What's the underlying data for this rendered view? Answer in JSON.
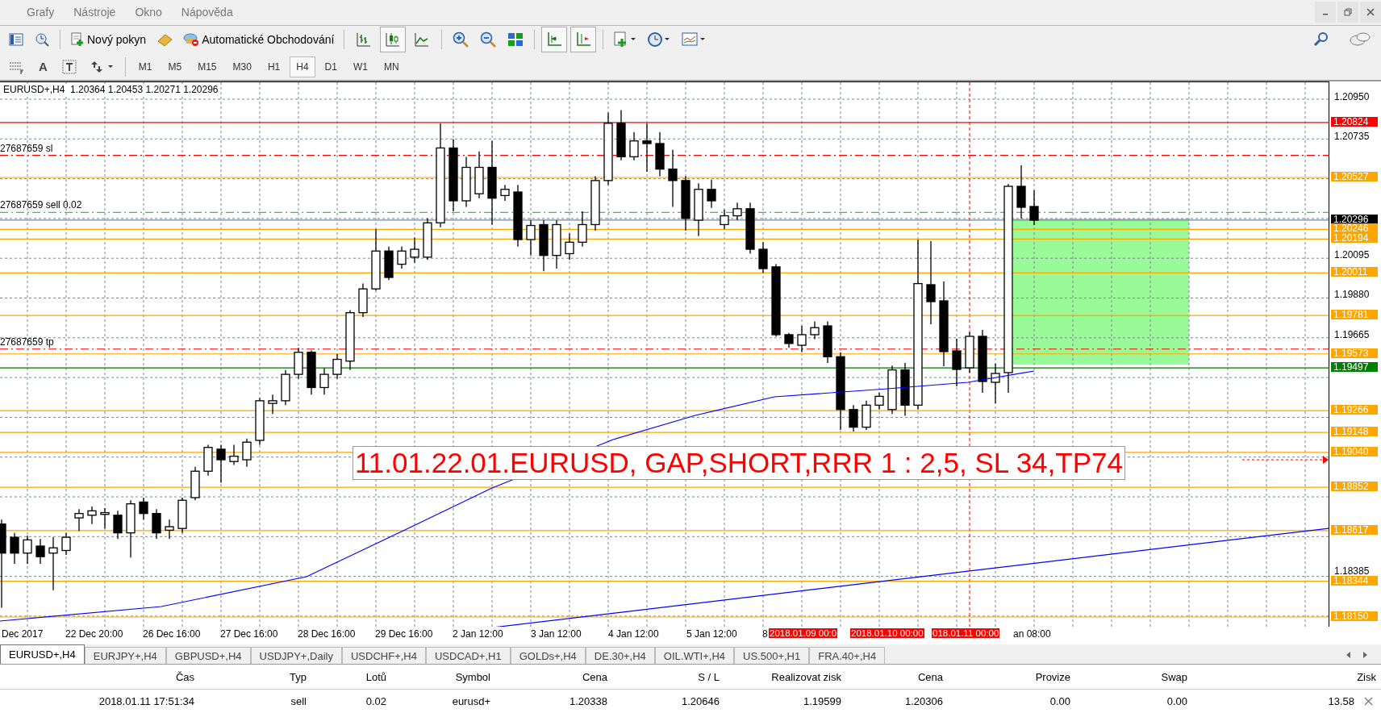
{
  "menu": [
    "Grafy",
    "Nástroje",
    "Okno",
    "Nápověda"
  ],
  "toolbar": {
    "new_order": "Nový pokyn",
    "auto_trading": "Automatické Obchodování",
    "chart_type_buttons": [
      {
        "selected": false
      },
      {
        "selected": true
      },
      {
        "selected": false
      }
    ]
  },
  "drawing_toolbar": {
    "text_tool": "A"
  },
  "timeframes": [
    {
      "label": "M1",
      "selected": false
    },
    {
      "label": "M5",
      "selected": false
    },
    {
      "label": "M15",
      "selected": false
    },
    {
      "label": "M30",
      "selected": false
    },
    {
      "label": "H1",
      "selected": false
    },
    {
      "label": "H4",
      "selected": true
    },
    {
      "label": "D1",
      "selected": false
    },
    {
      "label": "W1",
      "selected": false
    },
    {
      "label": "MN",
      "selected": false
    }
  ],
  "chart": {
    "header": "EURUSD+,H4  1.20364 1.20453 1.20271 1.20296",
    "order_lines": [
      {
        "label": "27687659 sl",
        "kind": "sl"
      },
      {
        "label": "27687659 sell 0.02",
        "kind": "entry"
      },
      {
        "label": "27687659 tp",
        "kind": "tp"
      }
    ],
    "annotation": "11.01.22.01.EURUSD, GAP,SHORT,RRR 1 : 2,5, SL 34,TP74",
    "price_ticks": [
      "1.20950",
      "1.20735",
      "1.20095",
      "1.19880",
      "1.19665",
      "1.18385"
    ],
    "levels": [
      {
        "price": "1.20824",
        "kind": "alert"
      },
      {
        "price": "1.20527",
        "kind": "level"
      },
      {
        "price": "1.20296",
        "kind": "bid"
      },
      {
        "price": "1.20246",
        "kind": "level"
      },
      {
        "price": "1.20194",
        "kind": "level"
      },
      {
        "price": "1.20011",
        "kind": "level"
      },
      {
        "price": "1.19781",
        "kind": "level"
      },
      {
        "price": "1.19573",
        "kind": "level"
      },
      {
        "price": "1.19497",
        "kind": "support"
      },
      {
        "price": "1.19266",
        "kind": "level"
      },
      {
        "price": "1.19148",
        "kind": "level"
      },
      {
        "price": "1.19040",
        "kind": "level"
      },
      {
        "price": "1.18852",
        "kind": "level"
      },
      {
        "price": "1.18617",
        "kind": "level"
      },
      {
        "price": "1.18344",
        "kind": "level"
      },
      {
        "price": "1.18150",
        "kind": "level"
      }
    ],
    "time_labels": [
      {
        "text": "Dec 2017",
        "kind": "time"
      },
      {
        "text": "22 Dec 20:00",
        "kind": "time"
      },
      {
        "text": "26 Dec 16:00",
        "kind": "time"
      },
      {
        "text": "27 Dec 16:00",
        "kind": "time"
      },
      {
        "text": "28 Dec 16:00",
        "kind": "time"
      },
      {
        "text": "29 Dec 16:00",
        "kind": "time"
      },
      {
        "text": "2 Jan 12:00",
        "kind": "time"
      },
      {
        "text": "3 Jan 12:00",
        "kind": "time"
      },
      {
        "text": "4 Jan 12:00",
        "kind": "time"
      },
      {
        "text": "5 Jan 12:00",
        "kind": "time"
      },
      {
        "text": "8",
        "kind": "time"
      },
      {
        "text": "2018.01.09 00:0",
        "kind": "marker"
      },
      {
        "text": "2018.01.10 00:00",
        "kind": "marker"
      },
      {
        "text": "018.01.11 00:00",
        "kind": "marker"
      },
      {
        "text": "an 08:00",
        "kind": "time"
      }
    ]
  },
  "tabs": [
    {
      "label": "EURUSD+,H4",
      "selected": true
    },
    {
      "label": "EURJPY+,H4",
      "selected": false
    },
    {
      "label": "GBPUSD+,H4",
      "selected": false
    },
    {
      "label": "USDJPY+,Daily",
      "selected": false
    },
    {
      "label": "USDCHF+,H4",
      "selected": false
    },
    {
      "label": "USDCAD+,H1",
      "selected": false
    },
    {
      "label": "GOLDs+,H4",
      "selected": false
    },
    {
      "label": "DE.30+,H4",
      "selected": false
    },
    {
      "label": "OIL.WTI+,H4",
      "selected": false
    },
    {
      "label": "US.500+,H1",
      "selected": false
    },
    {
      "label": "FRA.40+,H4",
      "selected": false
    }
  ],
  "trades": {
    "columns": [
      "Čas",
      "Typ",
      "Lotů",
      "Symbol",
      "Cena",
      "S / L",
      "Realizovat zisk",
      "Cena",
      "Provize",
      "Swap",
      "Zisk"
    ],
    "rows": [
      {
        "cells": [
          "2018.01.11 17:51:34",
          "sell",
          "0.02",
          "eurusd+",
          "1.20338",
          "1.20646",
          "1.19599",
          "1.20306",
          "0.00",
          "0.00",
          "13.58"
        ]
      }
    ]
  }
}
